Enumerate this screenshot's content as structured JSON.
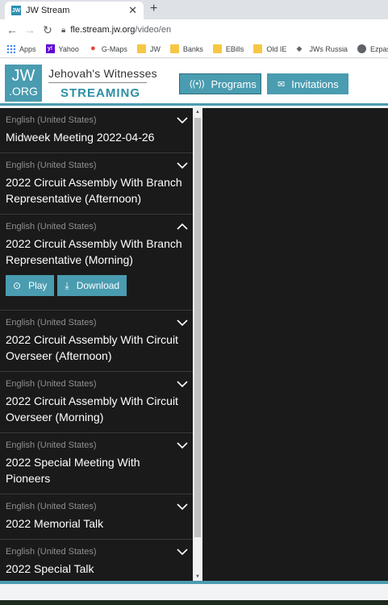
{
  "browser": {
    "tab_favicon": "JW",
    "tab_title": "JW Stream",
    "tab_close": "✕",
    "new_tab": "+",
    "url_domain": "fle.stream.jw.org",
    "url_path": "/video/en"
  },
  "bookmarks": [
    {
      "label": "Apps",
      "icon": "apps-grid-icon"
    },
    {
      "label": "Yahoo",
      "icon": "yahoo-icon"
    },
    {
      "label": "G-Maps",
      "icon": "map-pin-icon"
    },
    {
      "label": "JW",
      "icon": "folder-icon"
    },
    {
      "label": "Banks",
      "icon": "folder-icon"
    },
    {
      "label": "EBills",
      "icon": "folder-icon"
    },
    {
      "label": "Old IE",
      "icon": "folder-icon"
    },
    {
      "label": "JWs Russia",
      "icon": "jw-russia-icon"
    },
    {
      "label": "Ezpass",
      "icon": "globe-icon"
    }
  ],
  "header": {
    "logo_top": "JW",
    "logo_bottom": ".ORG",
    "brand_top": "Jehovah's Witnesses",
    "brand_bottom": "STREAMING",
    "programs_label": "Programs",
    "invitations_label": "Invitations"
  },
  "programs": [
    {
      "language": "English (United States)",
      "title": "Midweek Meeting 2022-04-26",
      "expanded": false
    },
    {
      "language": "English (United States)",
      "title": "2022 Circuit Assembly With Branch Representative (Afternoon)",
      "expanded": false
    },
    {
      "language": "English (United States)",
      "title": "2022 Circuit Assembly With Branch Representative (Morning)",
      "expanded": true
    },
    {
      "language": "English (United States)",
      "title": "2022 Circuit Assembly With Circuit Overseer (Afternoon)",
      "expanded": false
    },
    {
      "language": "English (United States)",
      "title": "2022 Circuit Assembly With Circuit Overseer (Morning)",
      "expanded": false
    },
    {
      "language": "English (United States)",
      "title": "2022 Special Meeting With Pioneers",
      "expanded": false
    },
    {
      "language": "English (United States)",
      "title": "2022 Memorial Talk",
      "expanded": false
    },
    {
      "language": "English (United States)",
      "title": "2022 Special Talk",
      "expanded": false
    }
  ],
  "actions": {
    "play_label": "Play",
    "download_label": "Download"
  },
  "colors": {
    "accent": "#4a9cb0",
    "panel": "#1a1a1a"
  }
}
